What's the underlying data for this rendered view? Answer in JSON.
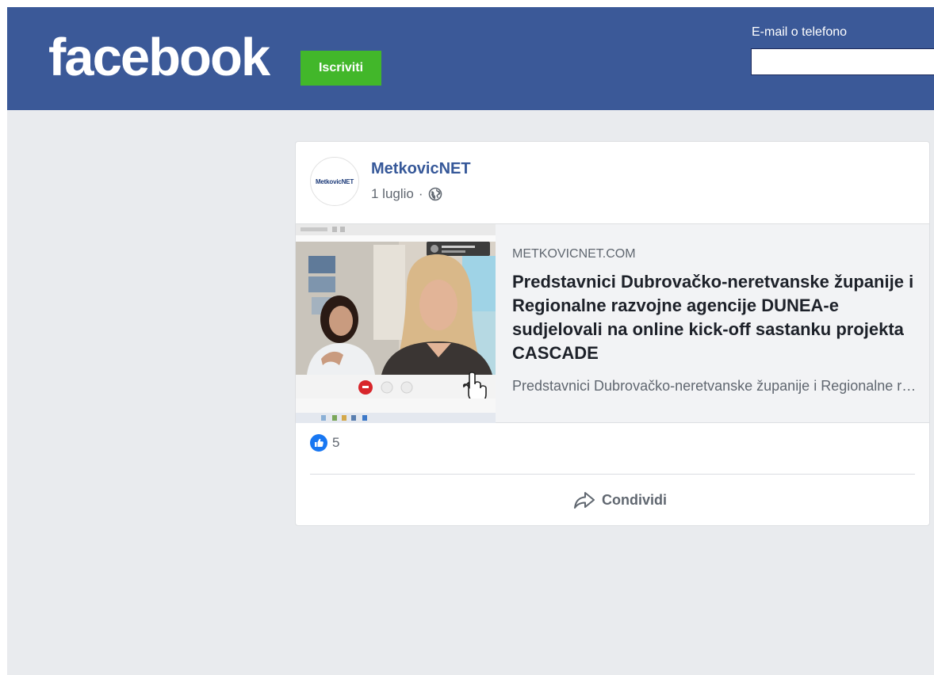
{
  "header": {
    "logo": "facebook",
    "signup_label": "Iscriviti",
    "login_label": "E-mail o telefono",
    "login_value": ""
  },
  "post": {
    "page_name": "MetkovicNET",
    "avatar_text": "MetkovicNET",
    "date": "1 luglio",
    "date_separator": "·",
    "privacy_icon": "globe-icon",
    "link": {
      "domain": "METKOVICNET.COM",
      "title": "Predstavnici Dubrovačko-neretvanske županije i Regionalne razvojne agencije DUNEA-e sudjelovali na online kick-off sastanku projekta CASCADE",
      "description": "Predstavnici Dubrovačko-neretvanske županije i Regionalne razvojne agencije DUNEA-e sudjelovali na online kick-off sastanku projekta CASCADE"
    },
    "reactions": {
      "icon": "like-icon",
      "count": "5"
    },
    "share_label": "Condividi",
    "share_icon": "share-icon"
  },
  "colors": {
    "brand": "#3b5998",
    "signup_green": "#42b72a",
    "page_bg": "#e9ebee",
    "link_blue": "#365899"
  }
}
